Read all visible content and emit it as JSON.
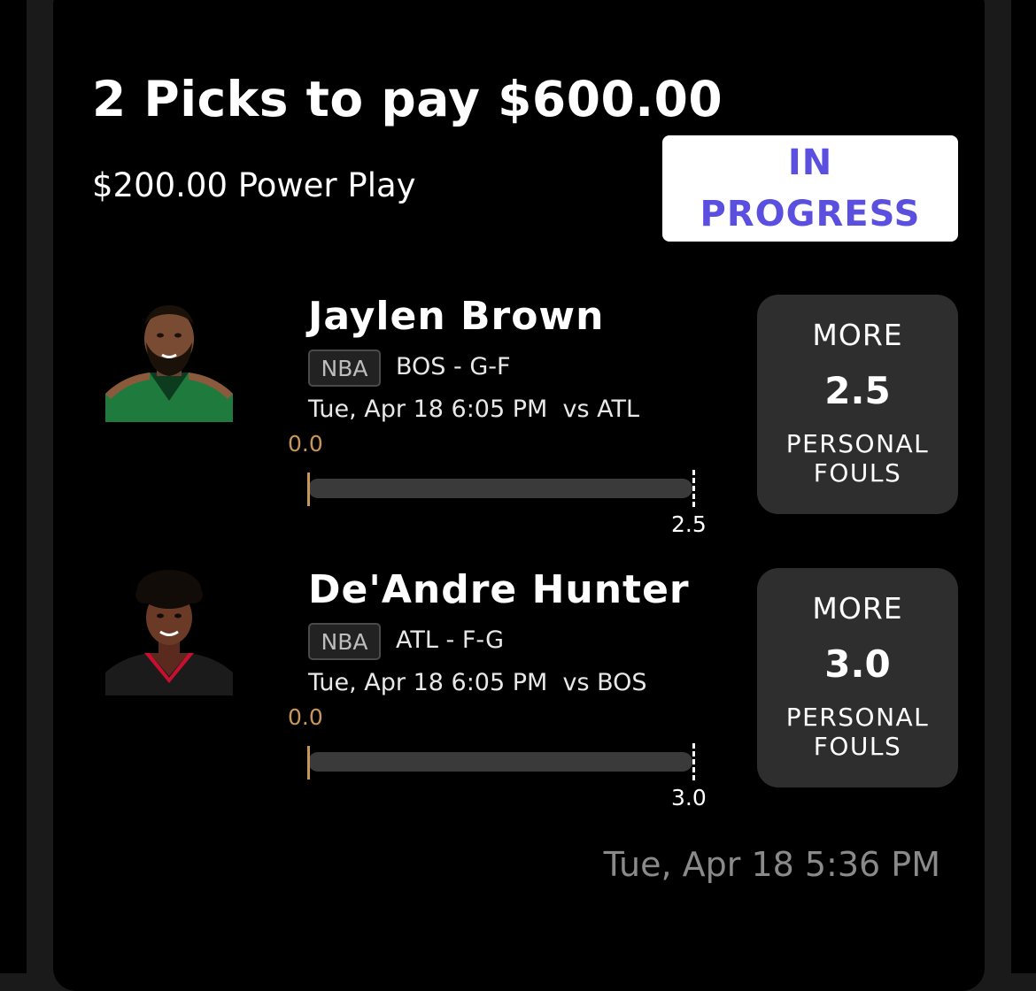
{
  "header": {
    "title": "2 Picks to pay $600.00",
    "subtitle": "$200.00 Power Play",
    "status_line1": "IN",
    "status_line2": "PROGRESS"
  },
  "picks": [
    {
      "player": "Jaylen Brown",
      "league": "NBA",
      "team_pos": "BOS - G-F",
      "game_time": "Tue, Apr 18 6:05 PM  vs ATL",
      "current_label": "0.0",
      "current_value": 0.0,
      "line_label": "2.5",
      "direction": "MORE",
      "line": "2.5",
      "stat_line1": "PERSONAL",
      "stat_line2": "FOULS",
      "jersey_color": "#1f7a3d"
    },
    {
      "player": "De'Andre Hunter",
      "league": "NBA",
      "team_pos": "ATL - F-G",
      "game_time": "Tue, Apr 18 6:05 PM  vs BOS",
      "current_label": "0.0",
      "current_value": 0.0,
      "line_label": "3.0",
      "direction": "MORE",
      "line": "3.0",
      "stat_line1": "PERSONAL",
      "stat_line2": "FOULS",
      "jersey_color": "#1b1b1b"
    }
  ],
  "footer": {
    "timestamp": "Tue, Apr 18 5:36 PM"
  },
  "colors": {
    "status_accent": "#5b4fe0",
    "progress_marker": "#c9965a",
    "pick_box_bg": "#2e2e2e"
  }
}
